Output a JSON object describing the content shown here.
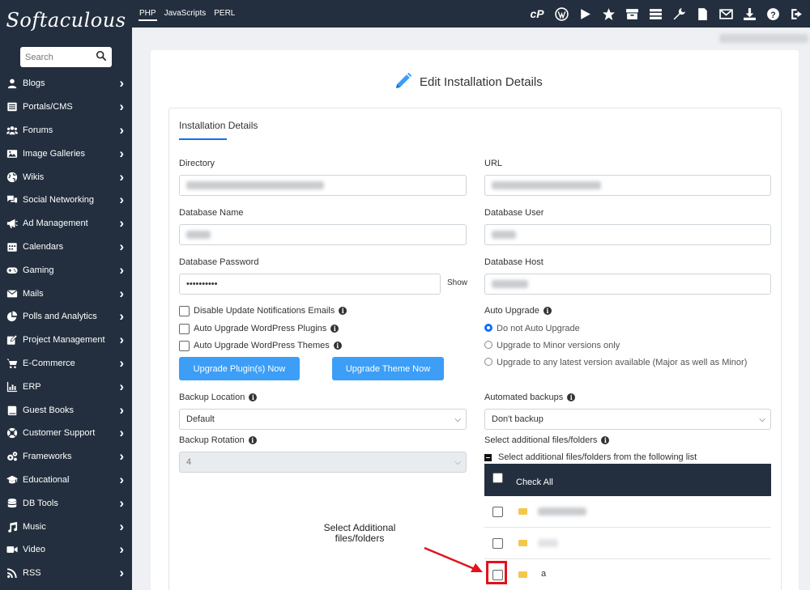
{
  "logo": "Softaculous",
  "search": {
    "placeholder": "Search"
  },
  "sidebar": {
    "items": [
      {
        "label": "Blogs",
        "icon": "user-icon"
      },
      {
        "label": "Portals/CMS",
        "icon": "list-icon"
      },
      {
        "label": "Forums",
        "icon": "users-icon"
      },
      {
        "label": "Image Galleries",
        "icon": "image-icon"
      },
      {
        "label": "Wikis",
        "icon": "globe-icon"
      },
      {
        "label": "Social Networking",
        "icon": "comments-icon"
      },
      {
        "label": "Ad Management",
        "icon": "megaphone-icon"
      },
      {
        "label": "Calendars",
        "icon": "calendar-icon"
      },
      {
        "label": "Gaming",
        "icon": "gamepad-icon"
      },
      {
        "label": "Mails",
        "icon": "envelope-icon"
      },
      {
        "label": "Polls and Analytics",
        "icon": "pie-chart-icon"
      },
      {
        "label": "Project Management",
        "icon": "edit-icon"
      },
      {
        "label": "E-Commerce",
        "icon": "cart-icon"
      },
      {
        "label": "ERP",
        "icon": "bar-chart-icon"
      },
      {
        "label": "Guest Books",
        "icon": "book-icon"
      },
      {
        "label": "Customer Support",
        "icon": "support-icon"
      },
      {
        "label": "Frameworks",
        "icon": "cogs-icon"
      },
      {
        "label": "Educational",
        "icon": "graduation-cap-icon"
      },
      {
        "label": "DB Tools",
        "icon": "database-icon"
      },
      {
        "label": "Music",
        "icon": "music-icon"
      },
      {
        "label": "Video",
        "icon": "video-icon"
      },
      {
        "label": "RSS",
        "icon": "rss-icon"
      }
    ]
  },
  "topbar": {
    "tabs": [
      "PHP",
      "JavaScripts",
      "PERL"
    ],
    "active_tab": "PHP",
    "icons": [
      "cpanel-icon",
      "wordpress-icon",
      "play-icon",
      "star-icon",
      "archive-icon",
      "list-icon",
      "wrench-icon",
      "file-icon",
      "envelope-icon",
      "download-icon",
      "help-icon",
      "logout-icon"
    ]
  },
  "page": {
    "title": "Edit Installation Details"
  },
  "card": {
    "tab_label": "Installation Details"
  },
  "form": {
    "directory_label": "Directory",
    "url_label": "URL",
    "db_name_label": "Database Name",
    "db_user_label": "Database User",
    "db_password_label": "Database Password",
    "db_password_value": "••••••••••",
    "show_label": "Show",
    "db_host_label": "Database Host",
    "disable_notifications_label": "Disable Update Notifications Emails",
    "auto_upgrade_plugins_label": "Auto Upgrade WordPress Plugins",
    "auto_upgrade_themes_label": "Auto Upgrade WordPress Themes",
    "auto_upgrade_label": "Auto Upgrade",
    "auto_upgrade_options": [
      "Do not Auto Upgrade",
      "Upgrade to Minor versions only",
      "Upgrade to any latest version available (Major as well as Minor)"
    ],
    "auto_upgrade_selected": 0,
    "upgrade_plugins_button": "Upgrade Plugin(s) Now",
    "upgrade_theme_button": "Upgrade Theme Now",
    "backup_location_label": "Backup Location",
    "backup_location_value": "Default",
    "automated_backups_label": "Automated backups",
    "automated_backups_value": "Don't backup",
    "backup_rotation_label": "Backup Rotation",
    "backup_rotation_value": "4",
    "additional_files_label": "Select additional files/folders",
    "additional_files_toggle": "Select additional files/folders from the following list",
    "check_all_label": "Check All",
    "file_rows": [
      "",
      "",
      "a"
    ]
  },
  "annotation": {
    "text": "Select Additional files/folders",
    "color": "#e3121b"
  },
  "colors": {
    "sidebar_bg": "#232f3e",
    "accent": "#3c9ef7",
    "tab_underline": "#0d6efd"
  }
}
